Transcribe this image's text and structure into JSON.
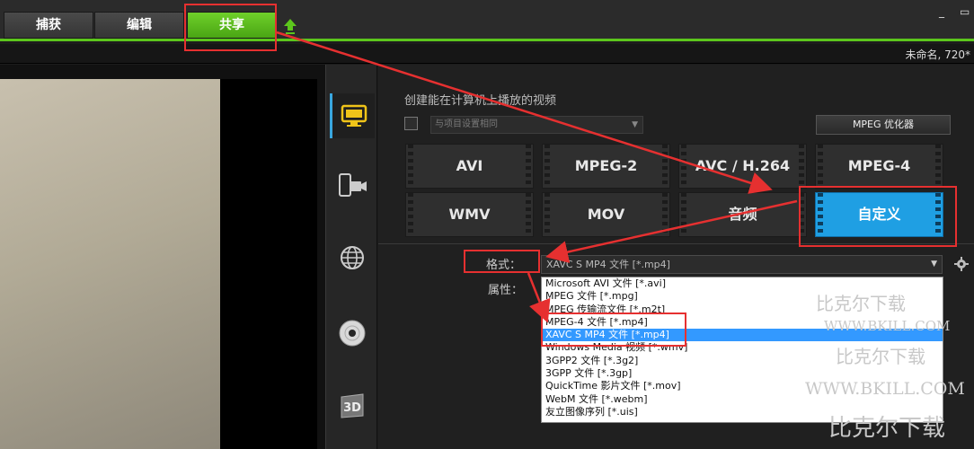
{
  "tabs": [
    {
      "label": "捕获",
      "active": false
    },
    {
      "label": "编辑",
      "active": false
    },
    {
      "label": "共享",
      "active": true
    }
  ],
  "window": {
    "minimize": "_",
    "restore": "▭"
  },
  "project_name": "未命名, 720*",
  "share": {
    "title": "创建能在计算机上播放的视频",
    "match_project_placeholder": "与项目设置相同",
    "mpeg_optimizer_label": "MPEG 优化器",
    "format_buttons": [
      "AVI",
      "MPEG-2",
      "AVC / H.264",
      "MPEG-4",
      "WMV",
      "MOV",
      "音频",
      "自定义"
    ],
    "selected_format_button": "自定义",
    "format_label": "格式：",
    "format_value": "XAVC S MP4 文件 [*.mp4]",
    "properties_label": "属性：",
    "dropdown_options": [
      "Microsoft AVI 文件 [*.avi]",
      "MPEG 文件 [*.mpg]",
      "MPEG 传输流文件 [*.m2t]",
      "MPEG-4 文件 [*.mp4]",
      "XAVC S MP4 文件 [*.mp4]",
      "Windows Media 视频 [*.wmv]",
      "3GPP2 文件 [*.3g2]",
      "3GPP 文件 [*.3gp]",
      "QuickTime 影片文件 [*.mov]",
      "WebM 文件 [*.webm]",
      "友立图像序列 [*.uis]"
    ],
    "selected_option": "XAVC S MP4 文件 [*.mp4]"
  },
  "rail_icons": [
    "computer-icon",
    "device-icon",
    "web-icon",
    "disc-icon",
    "3d-icon"
  ],
  "rail_3d_label": "3D",
  "watermarks": [
    "比克尔下载",
    "WWW.BKILL.COM",
    "比克尔下载",
    "WWW.BKILL.COM",
    "比克尔下载"
  ],
  "colors": {
    "accent_green": "#5cc61c",
    "accent_blue": "#1f9fe3",
    "highlight_red": "#e63030"
  }
}
